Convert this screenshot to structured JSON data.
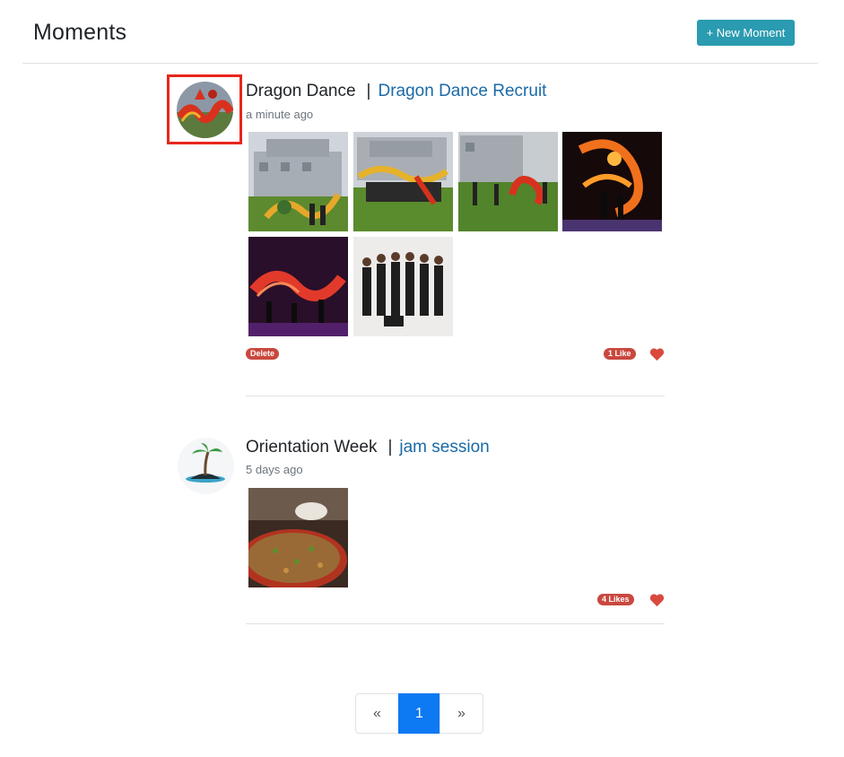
{
  "header": {
    "title": "Moments",
    "new_button_label": "+ New Moment"
  },
  "moments": [
    {
      "title": "Dragon Dance",
      "separator": "|",
      "link": "Dragon Dance Recruit",
      "time": "a minute ago",
      "avatar_icon": "dragon-dance-avatar",
      "photos": [
        "building-dragon-photo",
        "group-dragon-photo",
        "lawn-dragon-photo",
        "fire-dragon-photo",
        "stage-dragon-photo",
        "team-photo"
      ],
      "delete_label": "Delete",
      "likes_label": "1 Like",
      "colors": {
        "badge": "#c9483e",
        "heart": "#d9493e"
      }
    },
    {
      "title": "Orientation Week",
      "separator": "|",
      "link": "jam session",
      "time": "5 days ago",
      "avatar_icon": "island-avatar",
      "photos": [
        "fried-rice-photo"
      ],
      "likes_label": "4 Likes"
    }
  ],
  "pagination": {
    "prev": "«",
    "current": "1",
    "next": "»"
  },
  "colors": {
    "primary_button": "#2a9bb0",
    "link": "#1a6aa8",
    "active_page": "#0d79f2"
  }
}
